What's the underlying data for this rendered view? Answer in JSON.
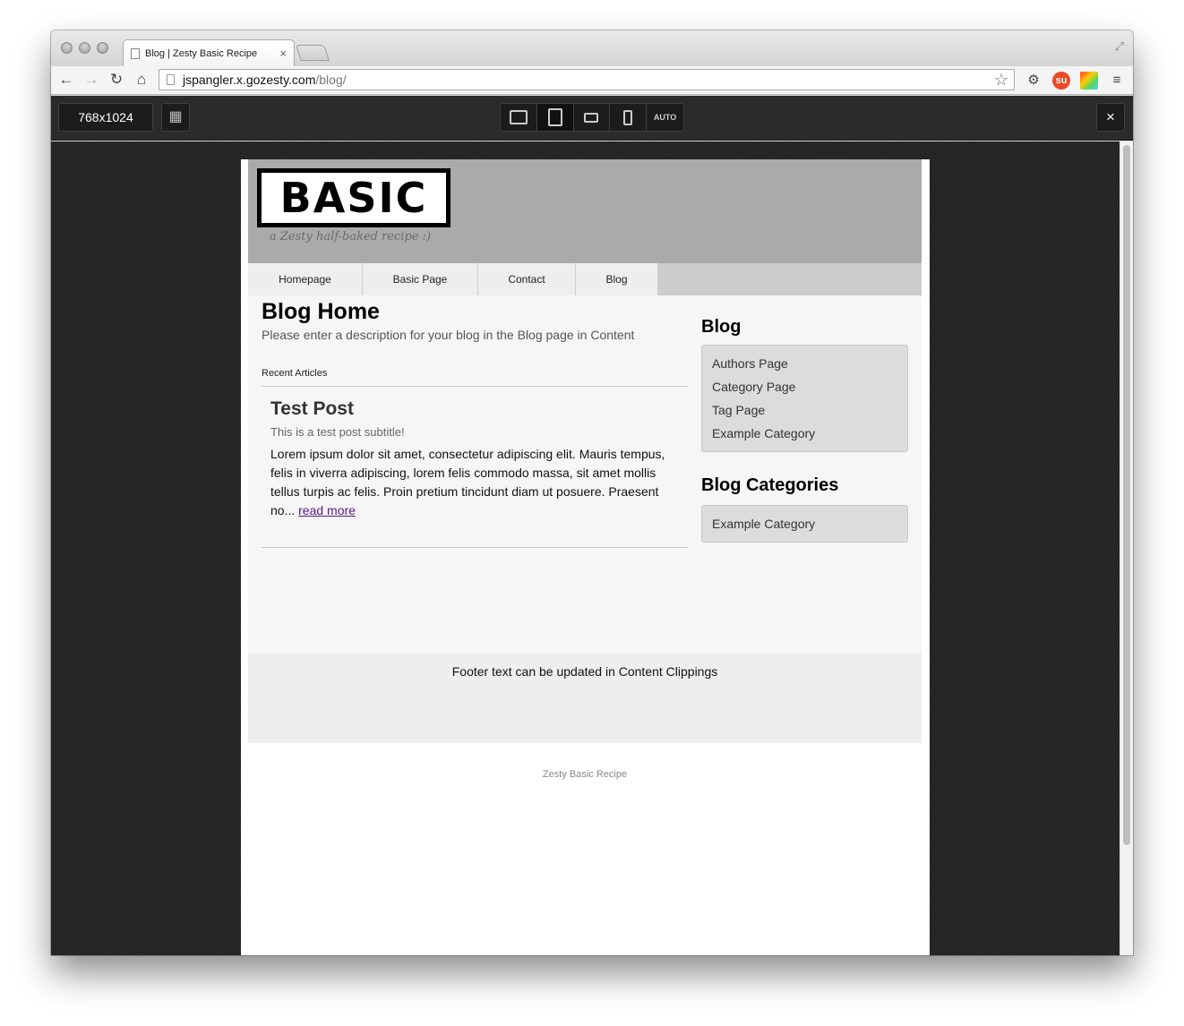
{
  "browser": {
    "tab_title": "Blog | Zesty Basic Recipe",
    "tab_close": "×",
    "url_host": "jspangler.x.gozesty.com",
    "url_path": "/blog/"
  },
  "resizer": {
    "dimensions": "768x1024",
    "auto_label": "AUTO",
    "close_label": "×"
  },
  "site": {
    "logo": "BASIC",
    "tagline": "a Zesty half-baked recipe :)",
    "nav": [
      "Homepage",
      "Basic Page",
      "Contact",
      "Blog"
    ],
    "page_title": "Blog Home",
    "page_description": "Please enter a description for your blog in the Blog page in Content",
    "recent_label": "Recent Articles",
    "post": {
      "title": "Test Post",
      "subtitle": "This is a test post subtitle!",
      "excerpt": "Lorem ipsum dolor sit amet, consectetur adipiscing elit. Mauris tempus, felis in viverra adipiscing, lorem felis commodo massa, sit amet mollis tellus turpis ac felis. Proin pretium tincidunt diam ut posuere. Praesent no...",
      "read_more": "read more"
    },
    "sidebar": {
      "blog_heading": "Blog",
      "blog_links": [
        "Authors Page",
        "Category Page",
        "Tag Page",
        "Example Category"
      ],
      "categories_heading": "Blog Categories",
      "category_links": [
        "Example Category"
      ]
    },
    "footer_text": "Footer text can be updated in Content Clippings",
    "below_footer": "Zesty Basic Recipe"
  }
}
